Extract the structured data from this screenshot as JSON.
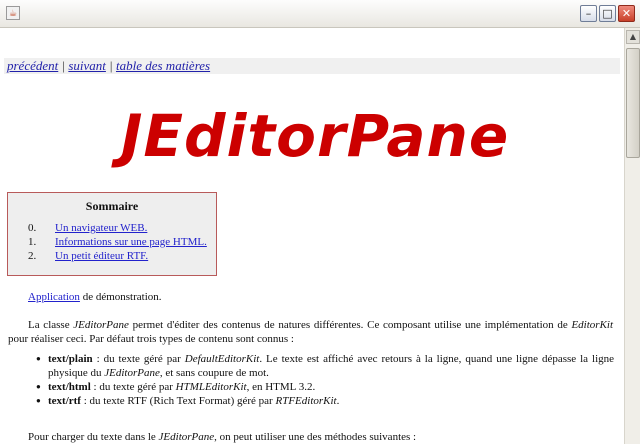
{
  "window": {
    "buttons": {
      "minimize": "–",
      "maximize": "□",
      "close": "✕"
    }
  },
  "nav": {
    "previous": "précédent",
    "next": "suivant",
    "toc": "table des matières",
    "separator": "|"
  },
  "heading": "JEditorPane",
  "summary": {
    "title": "Sommaire",
    "items": [
      {
        "num": "0.",
        "label": "Un navigateur WEB."
      },
      {
        "num": "1.",
        "label": "Informations sur une page HTML."
      },
      {
        "num": "2.",
        "label": "Un petit éditeur RTF."
      }
    ]
  },
  "content": {
    "intro_link": "Application",
    "intro_rest": " de démonstration.",
    "p2_a": "La classe ",
    "p2_class": "JEditorPane",
    "p2_b": " permet d'éditer des contenus de natures différentes. Ce composant utilise une implémentation de ",
    "p2_kit": "EditorKit",
    "p2_c": " pour réaliser ceci. Par défaut trois types de contenu sont connus :",
    "bullets": [
      {
        "type": "text/plain",
        "a": " : du texte géré par ",
        "kit": "DefaultEditorKit",
        "b": ". Le texte est affiché avec retours à la ligne, quand une ligne dépasse la ligne physique du ",
        "cls": "JEditorPane",
        "c": ", et sans coupure de mot."
      },
      {
        "type": "text/html",
        "a": " : du texte géré par ",
        "kit": "HTMLEditorKit",
        "b": ", en HTML 3.2."
      },
      {
        "type": "text/rtf",
        "a": " : du texte RTF (Rich Text Format) géré par ",
        "kit": "RTFEditorKit",
        "b": "."
      }
    ],
    "p3_a": "Pour charger du texte dans le ",
    "p3_cls": "JEditorPane",
    "p3_b": ", on peut utiliser une des méthodes suivantes :"
  },
  "colors": {
    "heading": "#cc0000",
    "link": "#2222cc",
    "summary_border": "#b85a5a"
  },
  "icons": {
    "app": "java-icon"
  }
}
